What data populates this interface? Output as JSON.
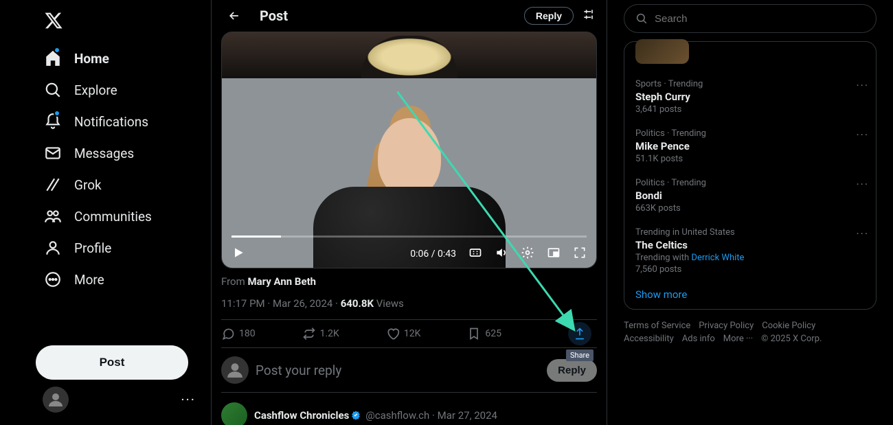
{
  "nav": {
    "items": [
      {
        "label": "Home",
        "icon": "home"
      },
      {
        "label": "Explore",
        "icon": "search"
      },
      {
        "label": "Notifications",
        "icon": "bell",
        "badge": true
      },
      {
        "label": "Messages",
        "icon": "mail"
      },
      {
        "label": "Grok",
        "icon": "grok"
      },
      {
        "label": "Communities",
        "icon": "people"
      },
      {
        "label": "Profile",
        "icon": "person"
      },
      {
        "label": "More",
        "icon": "more"
      }
    ],
    "post_label": "Post"
  },
  "header": {
    "title": "Post",
    "reply_label": "Reply"
  },
  "video": {
    "current": "0:06",
    "duration": "0:43"
  },
  "post": {
    "from_prefix": "From ",
    "from_name": "Mary Ann Beth",
    "time": "11:17 PM",
    "date": "Mar 26, 2024",
    "views_count": "640.8K",
    "views_label": "Views",
    "replies": "180",
    "retweets": "1.2K",
    "likes": "12K",
    "bookmarks": "625",
    "share_tooltip": "Share"
  },
  "reply_composer": {
    "placeholder": "Post your reply",
    "button": "Reply"
  },
  "next_reply": {
    "name": "Cashflow Chronicles",
    "handle": "@cashflow.ch",
    "date": "Mar 27, 2024"
  },
  "search": {
    "placeholder": "Search"
  },
  "trends": [
    {
      "category": "Sports · Trending",
      "topic": "Steph Curry",
      "posts": "3,641 posts"
    },
    {
      "category": "Politics · Trending",
      "topic": "Mike Pence",
      "posts": "51.1K posts"
    },
    {
      "category": "Politics · Trending",
      "topic": "Bondi",
      "posts": "663K posts"
    },
    {
      "category": "Trending in United States",
      "topic": "The Celtics",
      "trending_with": "Trending with ",
      "trending_link": "Derrick White",
      "posts": "7,560 posts"
    }
  ],
  "show_more": "Show more",
  "footer": {
    "tos": "Terms of Service",
    "privacy": "Privacy Policy",
    "cookie": "Cookie Policy",
    "access": "Accessibility",
    "ads": "Ads info",
    "more": "More ···",
    "copy": "© 2025 X Corp."
  }
}
